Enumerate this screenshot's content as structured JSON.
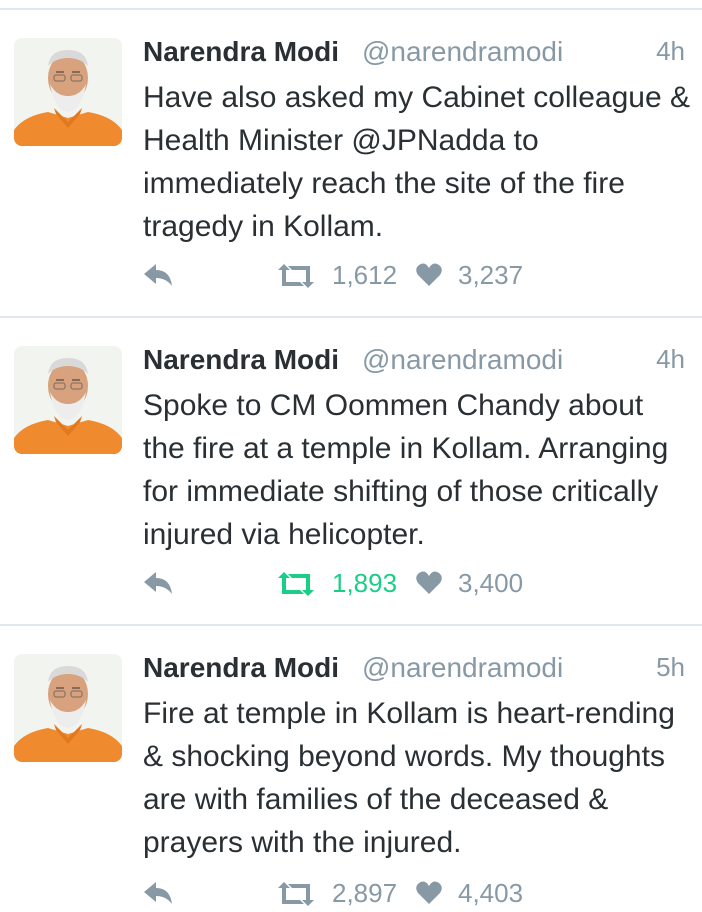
{
  "colors": {
    "text": "#292f33",
    "muted": "#8899a6",
    "retweeted": "#19cf86",
    "divider": "#e1e8ed",
    "avatar_bg": "#f2f4ef",
    "avatar_shirt": "#f08a2e"
  },
  "tweets": [
    {
      "author": "Narendra Modi",
      "handle": "@narendramodi",
      "time": "4h",
      "text": "Have also asked my Cabinet colleague & Health Minister  @JPNadda to immediately reach the site of the fire tragedy in Kollam.",
      "retweets": "1,612",
      "likes": "3,237",
      "retweeted": false
    },
    {
      "author": "Narendra Modi",
      "handle": "@narendramodi",
      "time": "4h",
      "text": "Spoke to CM Oommen Chandy about the fire at a temple in Kollam. Arranging for immediate shifting of those critically injured via helicopter.",
      "retweets": "1,893",
      "likes": "3,400",
      "retweeted": true
    },
    {
      "author": "Narendra Modi",
      "handle": "@narendramodi",
      "time": "5h",
      "text": "Fire at temple in Kollam is heart-rending & shocking beyond words. My thoughts are with families of the deceased & prayers with the injured.",
      "retweets": "2,897",
      "likes": "4,403",
      "retweeted": false
    }
  ],
  "icons": {
    "reply": "reply-arrow-icon",
    "retweet": "retweet-icon",
    "like": "heart-icon"
  }
}
